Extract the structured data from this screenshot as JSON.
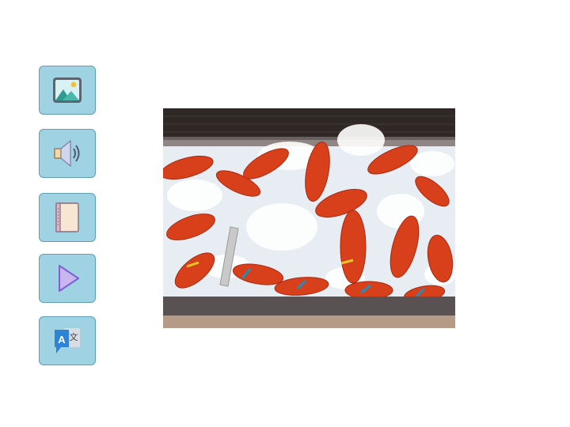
{
  "toolbar": {
    "buttons": [
      {
        "name": "image-button",
        "icon": "image-icon"
      },
      {
        "name": "audio-button",
        "icon": "speaker-icon"
      },
      {
        "name": "reading-button",
        "icon": "book-icon"
      },
      {
        "name": "play-button",
        "icon": "play-icon"
      },
      {
        "name": "translate-button",
        "icon": "translate-icon",
        "glyphs": [
          "A",
          "文"
        ]
      }
    ]
  },
  "photo": {
    "subject": "lobsters-on-ice-icon"
  },
  "colors": {
    "button_fill": "#9fd2e3",
    "button_border": "#5f9fb4",
    "lobster": "#d8401c",
    "ice": "#eef2f6"
  }
}
